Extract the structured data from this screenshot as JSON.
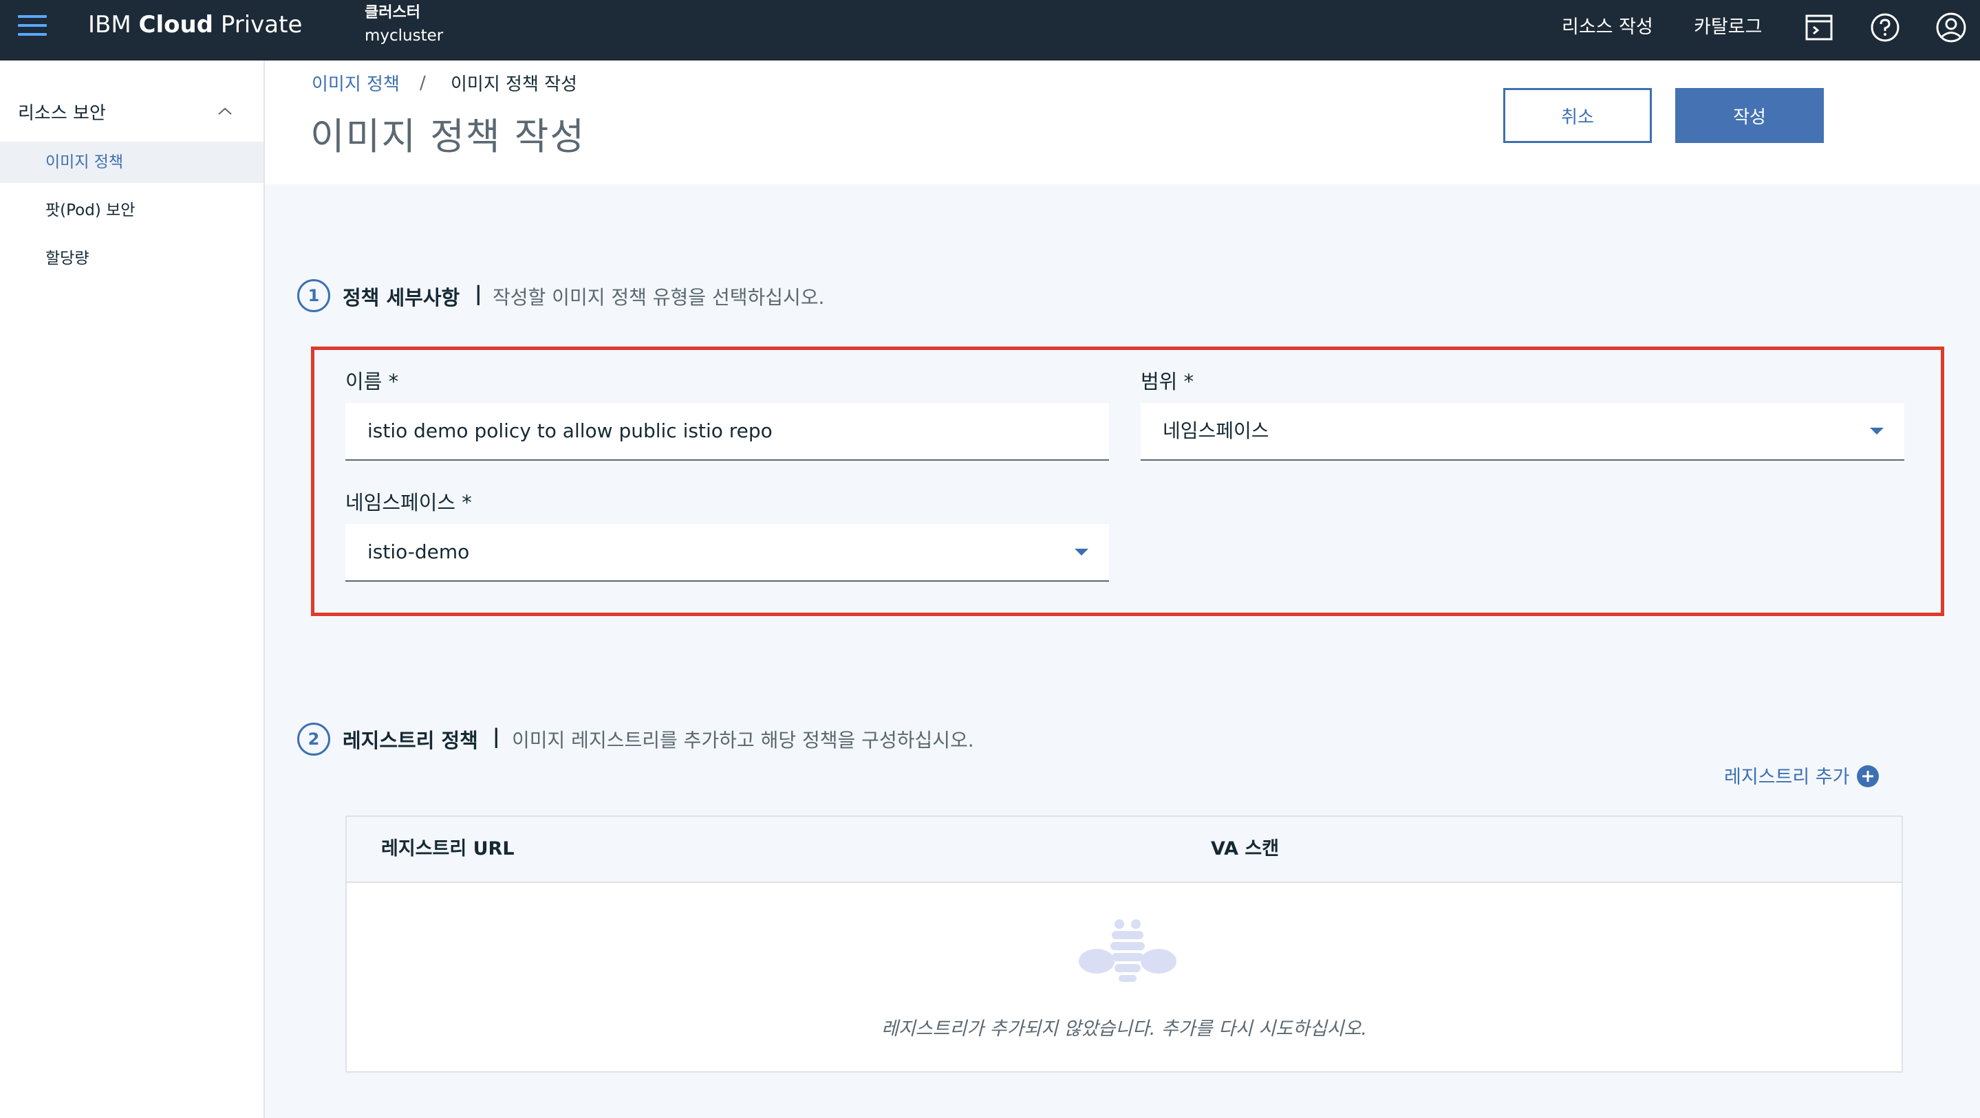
{
  "topbar": {
    "brand_regular": "IBM ",
    "brand_bold": "Cloud",
    "brand_suffix": " Private",
    "cluster_label": "클러스터",
    "cluster_name": "mycluster",
    "create_resource": "리소스 작성",
    "catalog": "카탈로그",
    "icons": [
      "menu-icon",
      "terminal-icon",
      "help-icon",
      "user-icon"
    ]
  },
  "sidebar": {
    "section": "리소스 보안",
    "items": [
      {
        "label": "이미지 정책",
        "active": true
      },
      {
        "label": "팟(Pod) 보안",
        "active": false
      },
      {
        "label": "할당량",
        "active": false
      }
    ]
  },
  "header": {
    "breadcrumb_link": "이미지 정책",
    "breadcrumb_sep": "/",
    "breadcrumb_current": "이미지 정책 작성",
    "title": "이미지 정책 작성",
    "cancel": "취소",
    "create": "작성"
  },
  "section1": {
    "number": "1",
    "title": "정책 세부사항",
    "bar": "|",
    "description": "작성할 이미지 정책 유형을 선택하십시오.",
    "name_label": "이름 *",
    "name_value": "istio demo policy to allow public istio repo",
    "scope_label": "범위 *",
    "scope_value": "네임스페이스",
    "namespace_label": "네임스페이스 *",
    "namespace_value": "istio-demo"
  },
  "section2": {
    "number": "2",
    "title": "레지스트리 정책",
    "bar": "|",
    "description": "이미지 레지스트리를 추가하고 해당 정책을 구성하십시오.",
    "add_registry": "레지스트리 추가",
    "columns": [
      "레지스트리 URL",
      "VA 스캔"
    ],
    "empty_message": "레지스트리가 추가되지 않았습니다. 추가를 다시 시도하십시오."
  },
  "colors": {
    "topbar": "#1d2a37",
    "accent": "#3d70b2",
    "highlight": "#dd3b2b"
  }
}
